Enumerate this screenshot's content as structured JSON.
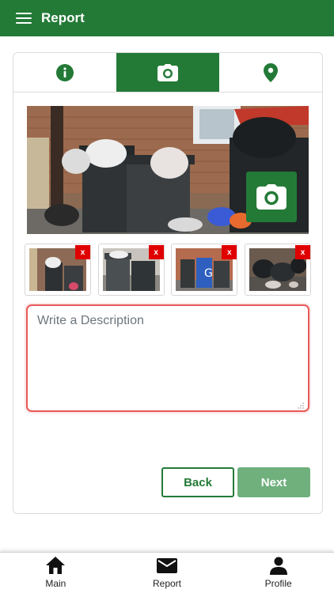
{
  "appbar": {
    "title": "Report",
    "menu_icon": "hamburger-menu-icon"
  },
  "tabs": [
    {
      "icon": "info-icon",
      "active": false
    },
    {
      "icon": "camera-icon",
      "active": true
    },
    {
      "icon": "location-pin-icon",
      "active": false
    }
  ],
  "photos": {
    "capture_icon": "camera-icon",
    "thumbnails": [
      {
        "delete_label": "x"
      },
      {
        "delete_label": "x"
      },
      {
        "delete_label": "x"
      },
      {
        "delete_label": "x"
      }
    ]
  },
  "description": {
    "placeholder": "Write a Description",
    "value": ""
  },
  "actions": {
    "back_label": "Back",
    "next_label": "Next"
  },
  "bottom_nav": [
    {
      "label": "Main",
      "icon": "home-icon"
    },
    {
      "label": "Report",
      "icon": "envelope-icon"
    },
    {
      "label": "Profile",
      "icon": "person-icon"
    }
  ],
  "colors": {
    "primary": "#237a37",
    "next_disabled": "#6fb07d",
    "delete_badge": "#e00000",
    "invalid_border": "#e85a5a"
  }
}
